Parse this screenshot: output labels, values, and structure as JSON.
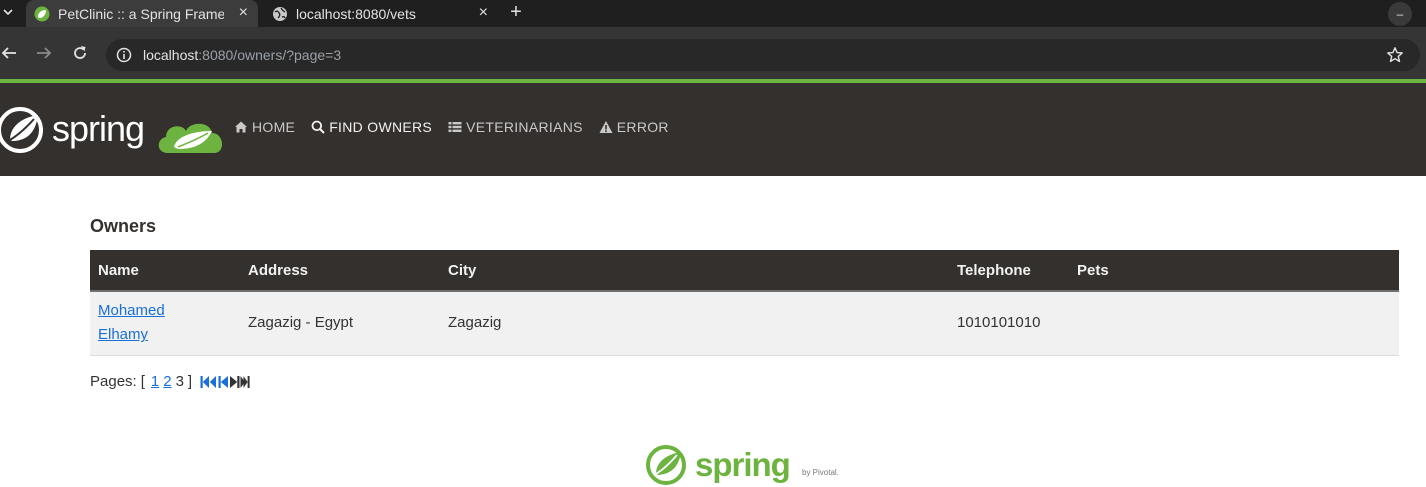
{
  "browser": {
    "tabs": [
      {
        "title": "PetClinic :: a Spring Framework demonstration",
        "active": true
      },
      {
        "title": "localhost:8080/vets",
        "active": false
      }
    ],
    "close_symbol": "×",
    "new_tab_symbol": "+",
    "minimize_symbol": "–",
    "address": {
      "host": "localhost",
      "rest": ":8080/owners/?page=3"
    }
  },
  "navbar": {
    "brand": {
      "text": "spring"
    },
    "links": [
      {
        "label": "HOME",
        "icon": "home-icon"
      },
      {
        "label": "FIND OWNERS",
        "icon": "search-icon",
        "active": true
      },
      {
        "label": "VETERINARIANS",
        "icon": "th-list-icon"
      },
      {
        "label": "ERROR",
        "icon": "warning-icon"
      }
    ]
  },
  "page": {
    "heading": "Owners",
    "table": {
      "headers": [
        "Name",
        "Address",
        "City",
        "Telephone",
        "Pets"
      ],
      "rows": [
        {
          "name": "Mohamed Elhamy",
          "address": "Zagazig - Egypt",
          "city": "Zagazig",
          "telephone": "1010101010",
          "pets": ""
        }
      ]
    },
    "pagination": {
      "label": "Pages:",
      "open": "[",
      "close": "]",
      "pages": [
        "1",
        "2",
        "3"
      ],
      "current": "3",
      "nav_icons": [
        "fast-backward-icon",
        "step-backward-icon",
        "step-forward-icon",
        "fast-forward-icon"
      ]
    }
  },
  "footer": {
    "logo_text": "spring",
    "by_text": "by Pivotal."
  },
  "colors": {
    "accent_green": "#6db33f",
    "navbar_bg": "#34302d",
    "link_blue": "#1a6fd8",
    "chrome_dark": "#1f1f1f",
    "chrome_toolbar": "#353535"
  }
}
